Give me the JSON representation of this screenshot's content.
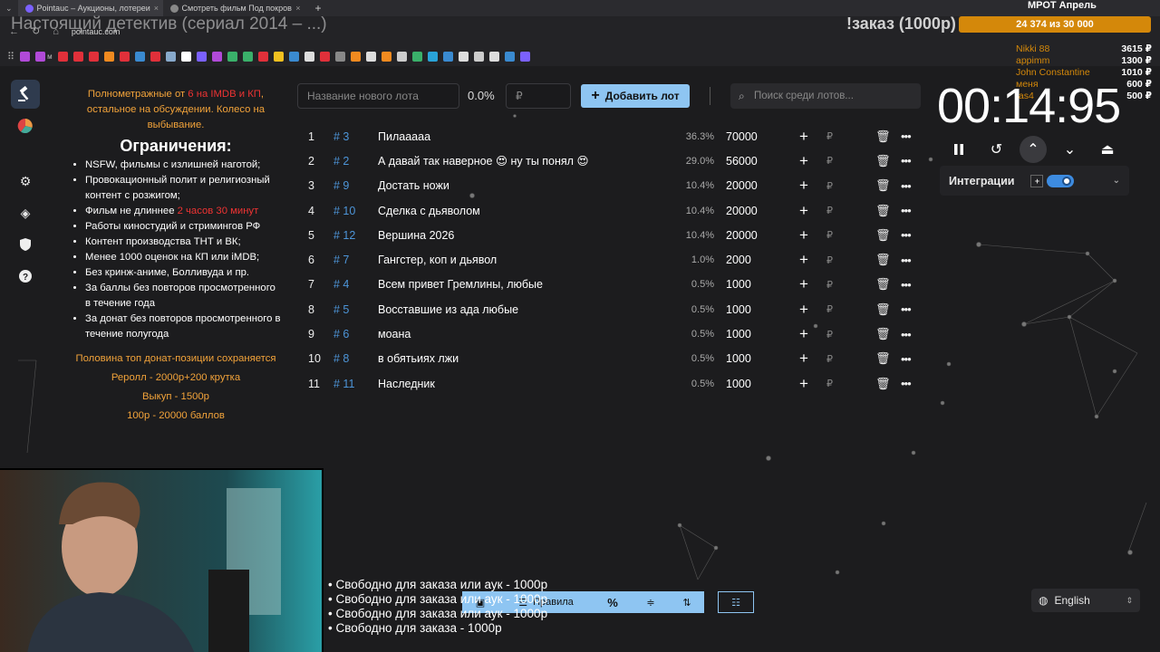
{
  "browser": {
    "tabs": [
      {
        "title": "Pointauc – Аукционы, лотереи",
        "active": true
      },
      {
        "title": "Смотреть фильм Под покров",
        "active": false
      }
    ],
    "url": "pointauc.com"
  },
  "overlay": {
    "title": "Настоящий детектив (сериал 2014 – ...)",
    "order": "!заказ (1000р)",
    "goal_title": "МРОТ Апрель",
    "goal_text": "24 374  из 30 000",
    "donors": [
      {
        "name": "Nikki 88",
        "amount": "3615 ₽"
      },
      {
        "name": "appimm",
        "amount": "1300 ₽"
      },
      {
        "name": "John Constantine",
        "amount": "1010 ₽"
      },
      {
        "name": "меня",
        "amount": "600 ₽"
      },
      {
        "name": "fas4",
        "amount": "500 ₽"
      }
    ]
  },
  "rules": {
    "intro_a": "Полнометражные от ",
    "intro_red": "6 на IMDB и КП",
    "intro_b": ", остальное на обсуждении. Колесо на выбывание.",
    "heading": "Ограничения:",
    "items": [
      "NSFW, фильмы с излишней наготой;",
      "Провокационный полит и религиозный контент с розжигом;",
      "Фильм не длиннее ",
      "Работы киностудий и стримингов РФ",
      "Контент производства ТНТ и ВК;",
      "Менее 1000 оценок на КП или iMDB;",
      "Без кринж-аниме, Болливуда и пр.",
      "За баллы без повторов просмотренного в течение года",
      "За донат без повторов просмотренного в течение полугода"
    ],
    "item3_red": "2 часов 30 минут",
    "notes": [
      "Половина топ донат-позиции сохраняется",
      "Реролл - 2000р+200 крутка",
      "Выкуп - 1500р",
      "100р - 20000 баллов"
    ]
  },
  "toolbar": {
    "lot_placeholder": "Название нового лота",
    "percent": "0.0%",
    "amount_placeholder": "₽",
    "add_label": "Добавить лот",
    "search_placeholder": "Поиск среди лотов..."
  },
  "lots": [
    {
      "n": "1",
      "id": "# 3",
      "name": "Пилааааа",
      "pct": "36.3%",
      "amount": "70000"
    },
    {
      "n": "2",
      "id": "# 2",
      "name": "А давай так наверное 😍 ну ты понял 😍",
      "pct": "29.0%",
      "amount": "56000"
    },
    {
      "n": "3",
      "id": "# 9",
      "name": "Достать ножи",
      "pct": "10.4%",
      "amount": "20000"
    },
    {
      "n": "4",
      "id": "# 10",
      "name": "Сделка с дьяволом",
      "pct": "10.4%",
      "amount": "20000"
    },
    {
      "n": "5",
      "id": "# 12",
      "name": "Вершина 2026",
      "pct": "10.4%",
      "amount": "20000"
    },
    {
      "n": "6",
      "id": "# 7",
      "name": "Гангстер, коп и дьявол",
      "pct": "1.0%",
      "amount": "2000"
    },
    {
      "n": "7",
      "id": "# 4",
      "name": "Всем привет Гремлины, любые",
      "pct": "0.5%",
      "amount": "1000"
    },
    {
      "n": "8",
      "id": "# 5",
      "name": "Восставшие из ада  любые",
      "pct": "0.5%",
      "amount": "1000"
    },
    {
      "n": "9",
      "id": "# 6",
      "name": "моана",
      "pct": "0.5%",
      "amount": "1000"
    },
    {
      "n": "10",
      "id": "# 8",
      "name": "в обятьиях лжи",
      "pct": "0.5%",
      "amount": "1000"
    },
    {
      "n": "11",
      "id": "# 11",
      "name": "Наследник",
      "pct": "0.5%",
      "amount": "1000"
    }
  ],
  "lot_currency": "₽",
  "timer": {
    "value": "00:14:95"
  },
  "integrations": {
    "label": "Интеграции",
    "enabled": true
  },
  "bottom": {
    "rules_label": "Правила",
    "percent_icon": "%"
  },
  "language": {
    "selected": "English"
  },
  "free_lines": [
    "• Свободно для заказа или аук - 1000р",
    "• Свободно для заказа или аук - 1000р",
    "• Свободно для заказа или аук - 1000р",
    "• Свободно для заказа - 1000р"
  ],
  "colors": {
    "accent": "#8ec5f2",
    "id_blue": "#4d95d8",
    "orange": "#f2a33a",
    "red": "#e33333",
    "bg": "#1c1c1e"
  }
}
